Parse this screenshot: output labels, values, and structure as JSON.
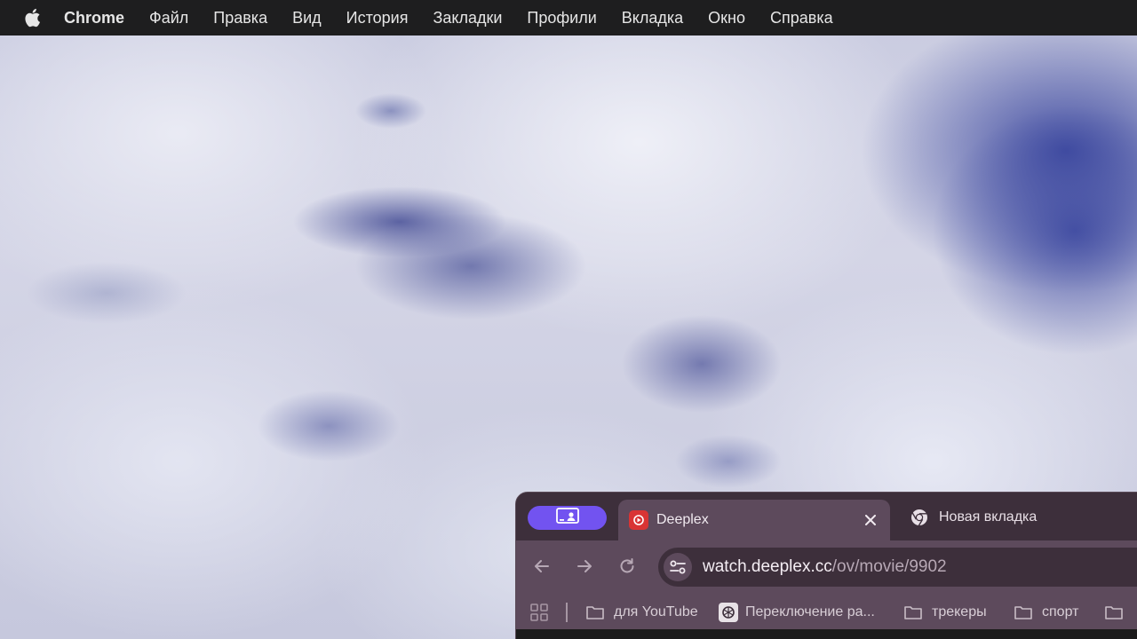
{
  "menubar": {
    "apple_icon": "apple-logo-icon",
    "app_name": "Chrome",
    "items": [
      "Файл",
      "Правка",
      "Вид",
      "История",
      "Закладки",
      "Профили",
      "Вкладка",
      "Окно",
      "Справка"
    ]
  },
  "browser": {
    "profile_button_icon": "profile-card-icon",
    "profile_color": "#7253f0",
    "tabs": [
      {
        "title": "Deeplex",
        "favicon": "deeplex-icon",
        "active": true,
        "close_icon": "close-icon"
      },
      {
        "title": "Новая вкладка",
        "favicon": "chrome-icon",
        "active": false
      }
    ],
    "toolbar": {
      "back_icon": "arrow-left-icon",
      "forward_icon": "arrow-right-icon",
      "reload_icon": "reload-icon",
      "site_info_icon": "tune-icon",
      "url_host": "watch.deeplex.cc",
      "url_path": "/ov/movie/9902"
    },
    "bookmarks": {
      "apps_icon": "apps-grid-icon",
      "items": [
        {
          "label": "для YouTube",
          "icon": "folder-icon"
        },
        {
          "label": "Переключение ра...",
          "icon": "chatgpt-icon"
        },
        {
          "label": "трекеры",
          "icon": "folder-icon"
        },
        {
          "label": "спорт",
          "icon": "folder-icon"
        },
        {
          "label": "",
          "icon": "folder-icon"
        }
      ]
    }
  },
  "colors": {
    "menubar_bg": "#1e1e1f",
    "tabstrip_bg": "#3d2f3b",
    "toolbar_bg": "#5d4a5c",
    "deeplex_red": "#d93434"
  }
}
